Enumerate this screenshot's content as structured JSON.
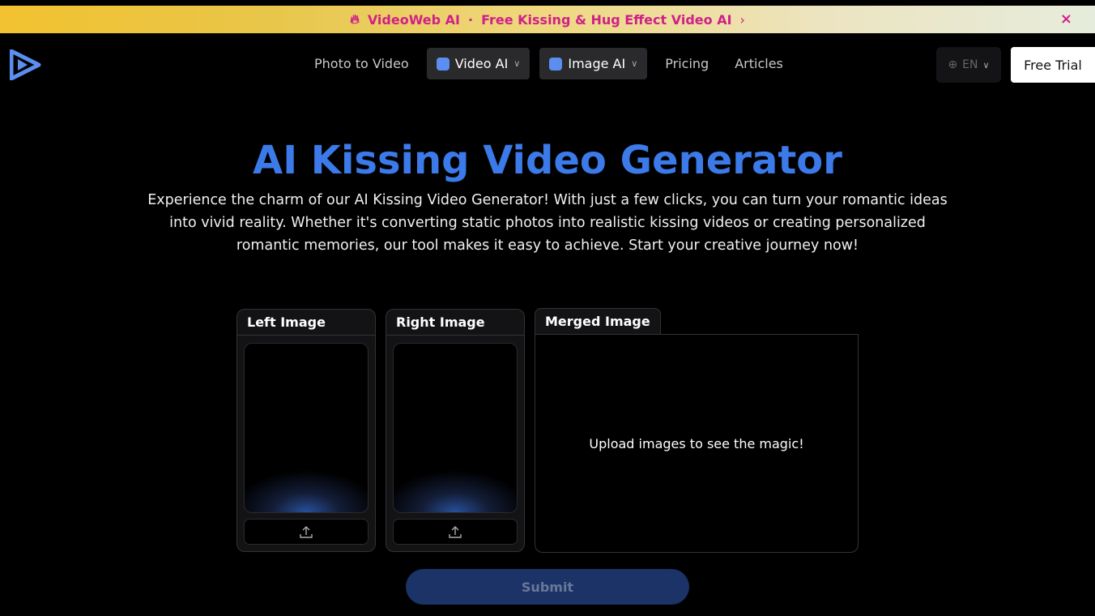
{
  "banner": {
    "brand": "VideoWeb AI",
    "sep": "·",
    "text": "Free Kissing & Hug Effect Video AI",
    "arrow": "›",
    "close": "×"
  },
  "nav": {
    "items": [
      "Photo to Video",
      "Video AI",
      "Image AI",
      "Pricing",
      "Articles"
    ],
    "lang": "EN",
    "trial": "Free Trial"
  },
  "hero": {
    "title": "AI Kissing Video Generator",
    "description": "Experience the charm of our AI Kissing Video Generator! With just a few clicks, you can turn your romantic ideas into vivid reality. Whether it's converting static photos into realistic kissing videos or creating personalized romantic memories, our tool makes it easy to achieve. Start your creative journey now!"
  },
  "tool": {
    "left": "Left Image",
    "right": "Right Image",
    "merged": "Merged Image",
    "placeholder": "Upload images to see the magic!",
    "submit": "Submit"
  },
  "colors": {
    "accent": "#3b7ae8",
    "banner_text": "#d0208a"
  }
}
